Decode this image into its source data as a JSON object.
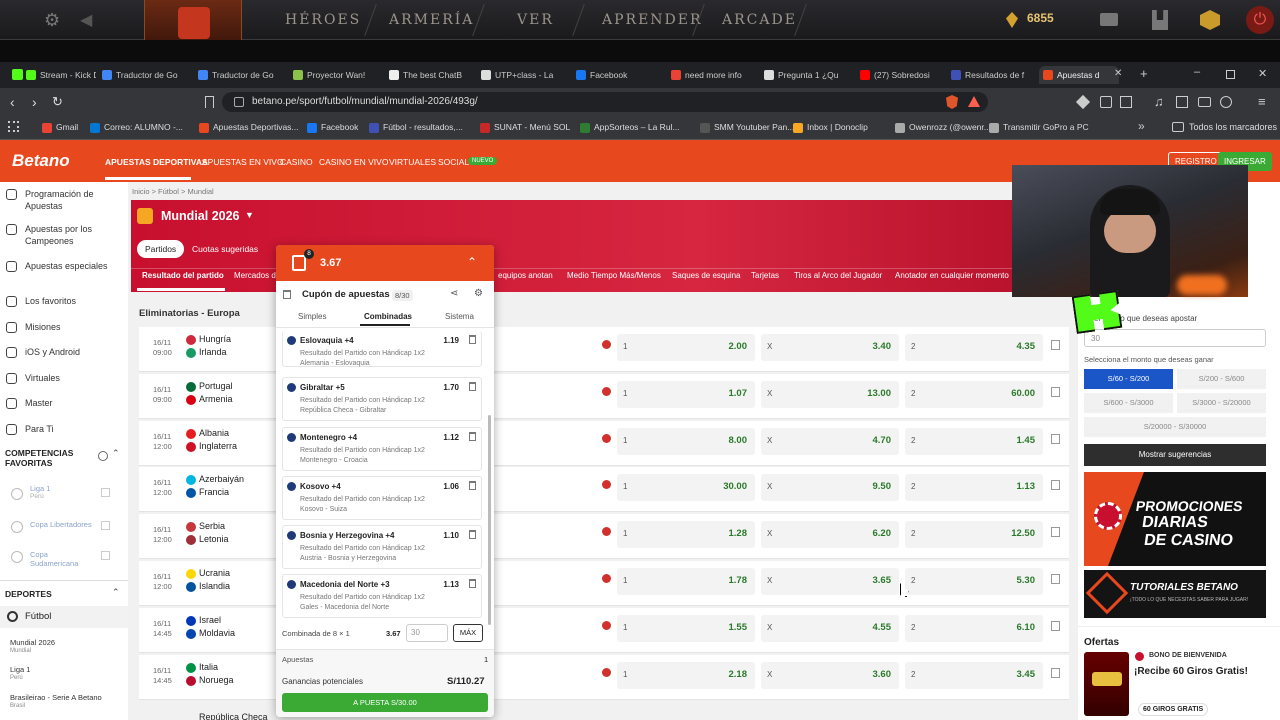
{
  "game": {
    "nav": [
      "HÉROES",
      "ARMERÍA",
      "VER",
      "APRENDER",
      "ARCADE"
    ],
    "shards": "6855"
  },
  "tabs": [
    {
      "label": "Stream - Kick D",
      "color": "#53fc18"
    },
    {
      "label": "Traductor de Go",
      "color": "#4285f4"
    },
    {
      "label": "Traductor de Go",
      "color": "#4285f4"
    },
    {
      "label": "Proyector Wan!",
      "color": "#8bc34a"
    },
    {
      "label": "The best ChatB",
      "color": "#eeeeee"
    },
    {
      "label": "UTP+class - La",
      "color": "#dddddd"
    },
    {
      "label": "Facebook",
      "color": "#1877f2"
    },
    {
      "label": "need more info",
      "color": "#ea4335"
    },
    {
      "label": "Pregunta 1 ¿Qu",
      "color": "#dddddd"
    },
    {
      "label": "(27) Sobredosi",
      "color": "#ff0000"
    },
    {
      "label": "Resultados de f",
      "color": "#3f51b5"
    },
    {
      "label": "Apuestas d",
      "color": "#e8481e"
    }
  ],
  "url": "betano.pe/sport/futbol/mundial/mundial-2026/493g/",
  "bookmarks": [
    {
      "label": "Gmail",
      "color": "#ea4335"
    },
    {
      "label": "Correo: ALUMNO -...",
      "color": "#0078d4"
    },
    {
      "label": "Apuestas Deportivas...",
      "color": "#e8481e"
    },
    {
      "label": "Facebook",
      "color": "#1877f2"
    },
    {
      "label": "Fútbol - resultados,...",
      "color": "#3f51b5"
    },
    {
      "label": "SUNAT - Menú SOL",
      "color": "#c62828"
    },
    {
      "label": "AppSorteos – La Rul...",
      "color": "#2e7d32"
    },
    {
      "label": "SMM Youtuber Pan...",
      "color": "#555555"
    },
    {
      "label": "Inbox | Donoclip",
      "color": "#f9a825"
    },
    {
      "label": "Owenrozz (@owenr...",
      "color": "#aaaaaa"
    },
    {
      "label": "Transmitir GoPro a PC",
      "color": "#aaaaaa"
    }
  ],
  "bookmarks_folder": "Todos los marcadores",
  "site": {
    "logo": "Betano",
    "nav": [
      "APUESTAS DEPORTIVAS",
      "APUESTAS EN VIVO",
      "CASINO",
      "CASINO EN VIVO",
      "VIRTUALES",
      "SOCIAL"
    ],
    "nuevo": "NUEVO",
    "registro": "REGISTRO",
    "ingresar": "INGRESAR"
  },
  "left": {
    "items": [
      "Programación de Apuestas",
      "Apuestas por los Campeones",
      "Apuestas especiales",
      "Los favoritos",
      "Misiones",
      "iOS y Android",
      "Virtuales",
      "Master",
      "Para Ti"
    ],
    "competencias": "COMPETENCIAS FAVORITAS",
    "fav": [
      {
        "l": "Liga 1",
        "s": "Perú"
      },
      {
        "l": "Copa Libertadores",
        "s": ""
      },
      {
        "l": "Copa Sudamericana",
        "s": ""
      }
    ],
    "deportes": "DEPORTES",
    "futbol": "Fútbol",
    "sub": [
      {
        "l": "Mundial 2026",
        "s": "Mundial"
      },
      {
        "l": "Liga 1",
        "s": "Perú"
      },
      {
        "l": "Brasileirao - Serie A Betano",
        "s": "Brasil"
      }
    ]
  },
  "main": {
    "crumb": "Inicio > Fútbol > Mundial",
    "title": "Mundial 2026",
    "pills": [
      "Partidos",
      "Cuotas sugeridas"
    ],
    "markets": [
      "Resultado del partido",
      "Mercados de",
      "equipos anotan",
      "Medio Tiempo Más/Menos",
      "Saques de esquina",
      "Tarjetas",
      "Tiros al Arco del Jugador",
      "Anotador en cualquier momento"
    ],
    "section": "Eliminatorias - Europa",
    "events": [
      {
        "d": "16/11",
        "t": "09:00",
        "h": "Hungría",
        "a": "Irlanda",
        "o1": "2.00",
        "ox": "3.40",
        "o2": "4.35",
        "fh": "#cd2a3e",
        "fa": "#169b62"
      },
      {
        "d": "16/11",
        "t": "09:00",
        "h": "Portugal",
        "a": "Armenia",
        "o1": "1.07",
        "ox": "13.00",
        "o2": "60.00",
        "fh": "#046a38",
        "fa": "#d90012"
      },
      {
        "d": "16/11",
        "t": "12:00",
        "h": "Albania",
        "a": "Inglaterra",
        "o1": "8.00",
        "ox": "4.70",
        "o2": "1.45",
        "fh": "#e41e20",
        "fa": "#ce1124"
      },
      {
        "d": "16/11",
        "t": "12:00",
        "h": "Azerbaiyán",
        "a": "Francia",
        "o1": "30.00",
        "ox": "9.50",
        "o2": "1.13",
        "fh": "#00b5e2",
        "fa": "#0055a4"
      },
      {
        "d": "16/11",
        "t": "12:00",
        "h": "Serbia",
        "a": "Letonia",
        "o1": "1.28",
        "ox": "6.20",
        "o2": "12.50",
        "fh": "#c6363c",
        "fa": "#9e3039"
      },
      {
        "d": "16/11",
        "t": "12:00",
        "h": "Ucrania",
        "a": "Islandia",
        "o1": "1.78",
        "ox": "3.65",
        "o2": "5.30",
        "fh": "#ffd700",
        "fa": "#02529c"
      },
      {
        "d": "16/11",
        "t": "14:45",
        "h": "Israel",
        "a": "Moldavia",
        "o1": "1.55",
        "ox": "4.55",
        "o2": "6.10",
        "fh": "#0038b8",
        "fa": "#0046ae"
      },
      {
        "d": "16/11",
        "t": "14:45",
        "h": "Italia",
        "a": "Noruega",
        "o1": "2.18",
        "ox": "3.60",
        "o2": "3.45",
        "fh": "#009246",
        "fa": "#ba0c2f"
      }
    ],
    "next": "República Checa"
  },
  "coupon": {
    "count": "8",
    "odds": "3.67",
    "title": "Cupón de apuestas",
    "of": "8/30",
    "tabs": [
      "Simples",
      "Combinadas",
      "Sistema"
    ],
    "items": [
      {
        "t": "Eslovaquia +4",
        "o": "1.19",
        "d1": "Resultado del Partido con Hándicap 1x2",
        "d2": "Alemania - Eslovaquia"
      },
      {
        "t": "Gibraltar +5",
        "o": "1.70",
        "d1": "Resultado del Partido con Hándicap 1x2",
        "d2": "República Checa - Gibraltar"
      },
      {
        "t": "Montenegro +4",
        "o": "1.12",
        "d1": "Resultado del Partido con Hándicap 1x2",
        "d2": "Montenegro - Croacia"
      },
      {
        "t": "Kosovo +4",
        "o": "1.06",
        "d1": "Resultado del Partido con Hándicap 1x2",
        "d2": "Kosovo - Suiza"
      },
      {
        "t": "Bosnia y Herzegovina +4",
        "o": "1.10",
        "d1": "Resultado del Partido con Hándicap 1x2",
        "d2": "Austria - Bosnia y Herzegovina"
      },
      {
        "t": "Macedonia del Norte +3",
        "o": "1.13",
        "d1": "Resultado del Partido con Hándicap 1x2",
        "d2": "Gales - Macedonia del Norte"
      }
    ],
    "combo": "Combinada de 8 × 1",
    "combo_odds": "3.67",
    "stake": "30",
    "max": "MÁX",
    "apuestas": "Apuestas",
    "apuestas_n": "1",
    "ganancias": "Ganancias potenciales",
    "ganancias_v": "S/110.27",
    "cta": "A PUESTA S/30.00"
  },
  "right": {
    "monto": "el monto que deseas apostar",
    "monto_val": "30",
    "ganar": "Selecciona el monto que deseas ganar",
    "ranges": [
      "S/60 - S/200",
      "S/200 - S/600",
      "S/600 - S/3000",
      "S/3000 - S/20000",
      "S/20000 - S/30000"
    ],
    "mostrar": "Mostrar sugerencias",
    "promo1a": "PROMOCIONES",
    "promo1b": "DIARIAS",
    "promo1c": "DE CASINO",
    "promo2a": "TUTORIALES BETANO",
    "promo2b": "¡TODO LO QUE NECESITAS SABER PARA JUGAR!",
    "ofertas": "Ofertas",
    "bono": "BONO DE BIENVENIDA",
    "giros": "¡Recibe 60 Giros Gratis!",
    "giros_badge": "60 GIROS GRATIS"
  }
}
